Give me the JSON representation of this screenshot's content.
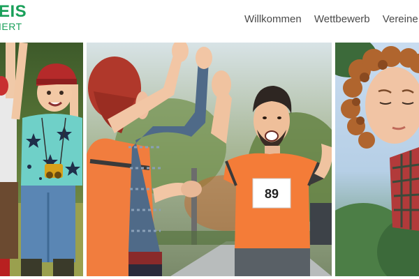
{
  "logo": {
    "line1": "EIS",
    "line2": "IERT"
  },
  "nav": {
    "items": [
      "Willkommen",
      "Wettbewerb",
      "Vereine"
    ]
  },
  "photos": [
    {
      "name": "boy-with-binoculars-photo"
    },
    {
      "name": "runners-high-five-photo",
      "bib_number": "89"
    },
    {
      "name": "curly-haired-boy-photo"
    }
  ],
  "colors": {
    "brand_green": "#1aa05a",
    "nav_text": "#4a4a4a",
    "runner_orange": "#f47c38"
  }
}
